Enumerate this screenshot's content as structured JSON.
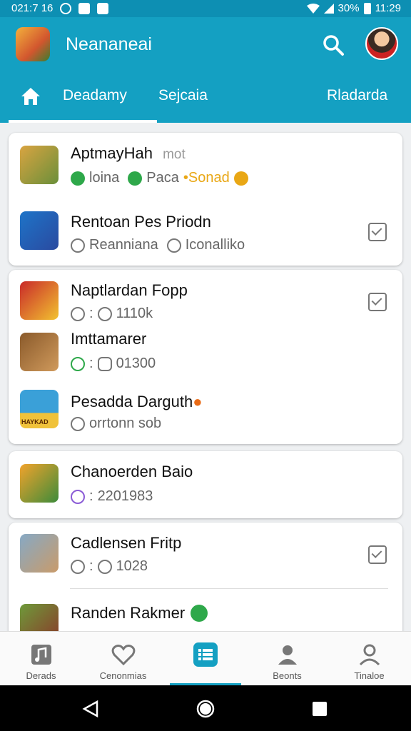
{
  "status": {
    "time_left": "021:7 16",
    "battery": "30%",
    "clock": "11:29"
  },
  "app": {
    "title": "Neananeai"
  },
  "tabs": [
    {
      "label": "Deadamy"
    },
    {
      "label": "Sejcaia"
    },
    {
      "label": "Rladarda"
    }
  ],
  "cards": [
    {
      "items": [
        {
          "name": "AptmayHah",
          "tag": "mot",
          "meta": [
            "loina",
            "Paca",
            "•Sonad"
          ],
          "thumb_colors": [
            "#d9a441",
            "#6a8f3a"
          ]
        },
        {
          "name": "Rentoan Pes Priodn",
          "meta": [
            "Reanniana",
            "Iconalliko"
          ],
          "thumb_colors": [
            "#1e74c8",
            "#2a4aa0"
          ],
          "checked": true
        }
      ]
    },
    {
      "items": [
        {
          "name": "Naptlardan Fopp",
          "meta": [
            "1110k"
          ],
          "thumb_colors": [
            "#c92a2a",
            "#f2c230"
          ],
          "checked": true
        },
        {
          "name": "Imttamarer",
          "meta": [
            "01300"
          ],
          "thumb_colors": [
            "#8a5a2b",
            "#d09a5c"
          ]
        },
        {
          "name": "Pesadda Darguth",
          "meta": [
            "orrtonn sob"
          ],
          "thumb_colors": [
            "#3aa0d8",
            "#f0c23a"
          ],
          "sub_label": "HAYKAD"
        }
      ]
    },
    {
      "items": [
        {
          "name": "Chanoerden Baio",
          "meta": [
            "2201983"
          ],
          "thumb_colors": [
            "#f1a32c",
            "#3d8b3a"
          ]
        }
      ]
    },
    {
      "items": [
        {
          "name": "Cadlensen Fritp",
          "meta": [
            "1028"
          ],
          "thumb_colors": [
            "#86a9c5",
            "#c99b6a"
          ],
          "checked": true
        },
        {
          "name": "Randen Rakmer",
          "meta": [],
          "thumb_colors": [
            "#6e9a3a",
            "#8a3a2a"
          ]
        }
      ]
    }
  ],
  "bottom_nav": [
    {
      "label": "Derads",
      "icon": "music-icon"
    },
    {
      "label": "Cenonmias",
      "icon": "heart-icon"
    },
    {
      "label": "",
      "icon": "list-icon",
      "active": true
    },
    {
      "label": "Beonts",
      "icon": "person-icon"
    },
    {
      "label": "Tinaloe",
      "icon": "profile-icon"
    }
  ],
  "colors": {
    "primary": "#14a0c2",
    "status_bar": "#0d8fb3",
    "green": "#2ea84a",
    "gold": "#e9a715"
  }
}
